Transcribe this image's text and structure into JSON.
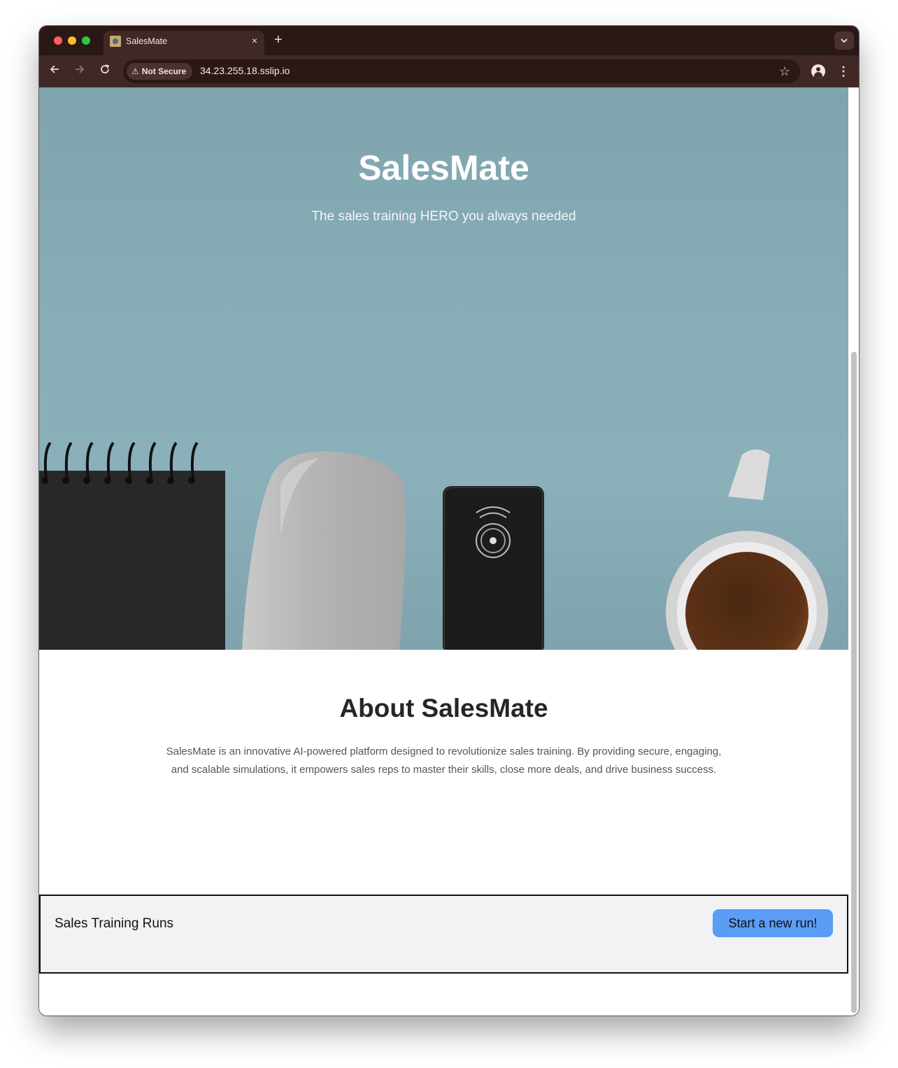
{
  "browser": {
    "tab_title": "SalesMate",
    "tab_close": "×",
    "new_tab": "+",
    "tab_menu": "⌄",
    "security_label": "Not Secure",
    "url": "34.23.255.18.sslip.io",
    "icons": {
      "back": "arrow-left-icon",
      "forward": "arrow-right-icon",
      "reload": "reload-icon",
      "warning": "warning-triangle-icon",
      "bookmark": "star-icon",
      "profile": "person-icon",
      "menu": "kebab-menu-icon"
    }
  },
  "hero": {
    "title": "SalesMate",
    "subtitle": "The sales training HERO you always needed"
  },
  "about": {
    "title": "About SalesMate",
    "text": "SalesMate is an innovative AI-powered platform designed to revolutionize sales training. By providing secure, engaging, and scalable simulations, it empowers sales reps to master their skills, close more deals, and drive business success."
  },
  "runs": {
    "title": "Sales Training Runs",
    "button_label": "Start a new run!"
  },
  "colors": {
    "browser_frame": "#2a1816",
    "browser_toolbar": "#3f2825",
    "hero_background": "#86acb6",
    "button_accent": "#5b9cf6",
    "panel_background": "#f2f2f4"
  }
}
